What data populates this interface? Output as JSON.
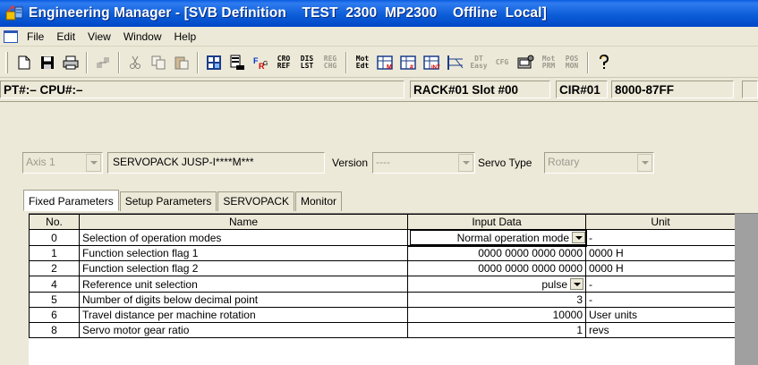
{
  "window": {
    "title": "Engineering Manager - [SVB Definition    TEST  2300  MP2300    Offline  Local]"
  },
  "menu": [
    "File",
    "Edit",
    "View",
    "Window",
    "Help"
  ],
  "toolbar": {
    "text_buttons": {
      "cro_ref": "CRO\nREF",
      "dis_lst": "DIS\nLST",
      "reg_chg": "REG\nCHG",
      "mot_edt": "Mot\nEdt",
      "dt_easy": "DT\nEasy",
      "cfg": "CFG",
      "mot_prm": "Mot\nPRM",
      "pos_mon": "POS\nMON"
    }
  },
  "status": {
    "pt_cpu": "PT#:– CPU#:–",
    "rack": "RACK#01  Slot #00",
    "cir": "CIR#01",
    "addr": "8000-87FF"
  },
  "header_controls": {
    "axis": "Axis 1",
    "servopack": "SERVOPACK  JUSP-I****M***",
    "version_label": "Version",
    "version_value": "----",
    "servo_type_label": "Servo Type",
    "servo_type_value": "Rotary"
  },
  "tabs": [
    {
      "label": "Fixed Parameters"
    },
    {
      "label": "Setup Parameters"
    },
    {
      "label": "SERVOPACK"
    },
    {
      "label": "Monitor"
    }
  ],
  "grid": {
    "columns": [
      "No.",
      "Name",
      "Input Data",
      "Unit"
    ],
    "rows": [
      {
        "no": "0",
        "name": "Selection of operation modes",
        "input": "Normal operation mode",
        "unit": "-"
      },
      {
        "no": "1",
        "name": "Function selection flag 1",
        "input": "0000 0000 0000 0000",
        "unit": "0000 H"
      },
      {
        "no": "2",
        "name": "Function selection flag 2",
        "input": "0000 0000 0000 0000",
        "unit": "0000 H"
      },
      {
        "no": "4",
        "name": "Reference unit selection",
        "input": "pulse",
        "unit": "-"
      },
      {
        "no": "5",
        "name": "Number of digits below decimal point",
        "input": "3",
        "unit": "-"
      },
      {
        "no": "6",
        "name": "Travel distance per machine rotation",
        "input": "10000",
        "unit": "User units"
      },
      {
        "no": "8",
        "name": "Servo motor gear ratio",
        "input": "1",
        "unit": "revs"
      }
    ]
  },
  "colors": {
    "titlebar": "#0d5ed8",
    "face": "#ece9d8"
  }
}
